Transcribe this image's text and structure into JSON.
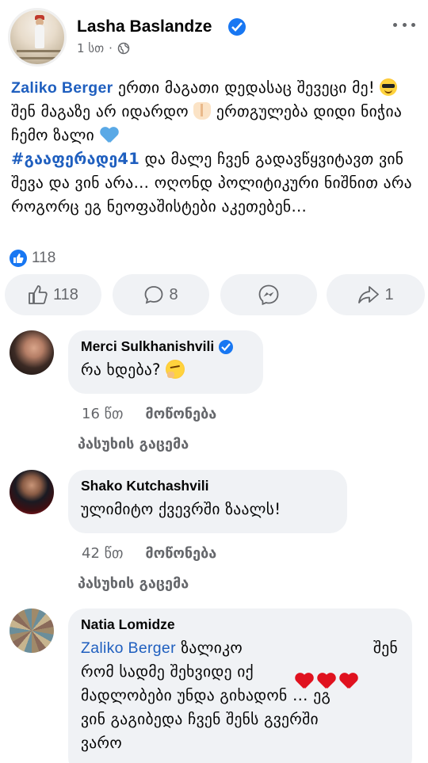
{
  "post": {
    "author": "Lasha Baslandze",
    "time": "1 სთ",
    "separator": "·",
    "text_mention": "Zaliko Berger",
    "text_part1": " ერთი მაგათი დედასაც შევეცი მე! ",
    "text_part2": " შენ მაგაზე არ იდარდო ",
    "text_part3": " ერთგულება დიდი ნიჭია ჩემო ზალი ",
    "hashtag": "#გააფერადე41",
    "text_part4": " და მალე ჩვენ გადავწყვიტავთ ვინ შევა და ვინ არა… ოღონდ პოლიტიკური ნიშნით არა როგორც ეგ ნეოფაშისტები აკეთებენ…",
    "reaction_count": "118",
    "icons": {
      "verified": "verified-badge-icon",
      "globe": "globe-icon",
      "more": "more-dots-icon"
    }
  },
  "actions": {
    "like_count": "118",
    "comment_count": "8",
    "share_count": "1"
  },
  "comments": [
    {
      "author": "Merci Sulkhanishvili",
      "text": "რა ხდება? ",
      "time": "16 წთ",
      "like": "მოწონება",
      "reply": "პასუხის გაცემა"
    },
    {
      "author": "Shako Kutchashvili",
      "text": "ულიმიტო ქვევრში ზაალს!",
      "time": "42 წთ",
      "like": "მოწონება",
      "reply": "პასუხის გაცემა"
    },
    {
      "author": "Natia Lomidze",
      "mention": "Zaliko Berger",
      "line1": " ზალიკო",
      "line1_end": "შენ",
      "line2": "რომ სადმე შეხვიდე  იქ",
      "line3": "მადლობები უნდა გიხადონ … ეგ",
      "line4": "ვინ გაგიბედა  ჩვენ შენს გვერში",
      "line5": "ვარო"
    }
  ],
  "colors": {
    "link": "#1f5fbf",
    "facebook_blue": "#1877f2",
    "bubble_bg": "#f0f2f5",
    "secondary_text": "#65676b"
  }
}
